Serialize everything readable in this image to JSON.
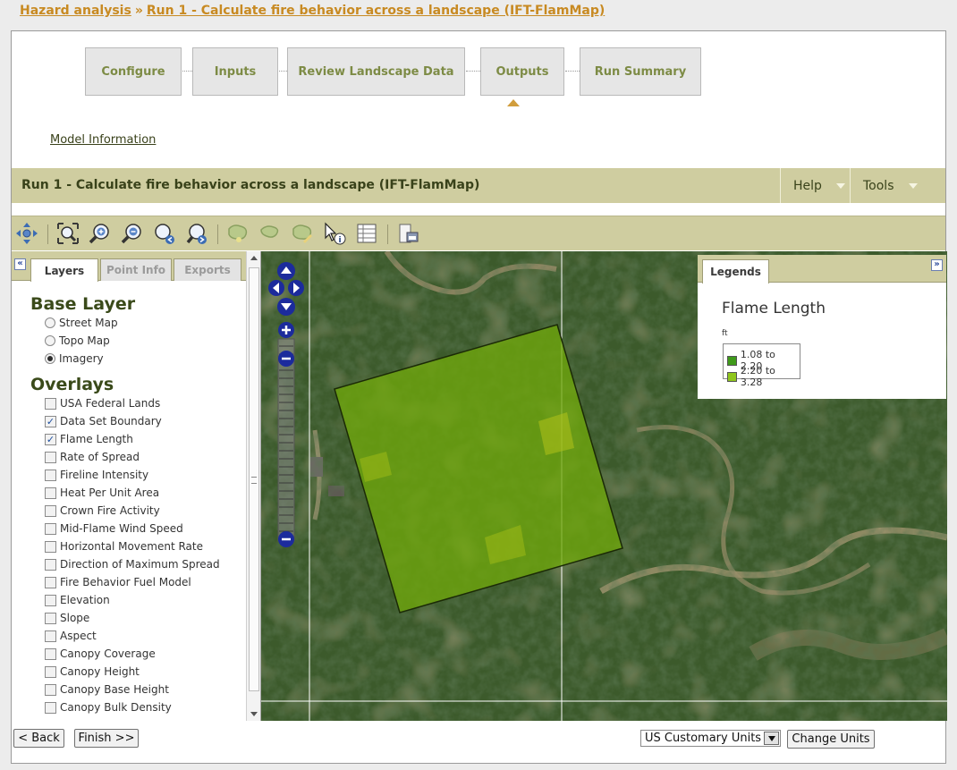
{
  "breadcrumb": {
    "root": "Hazard analysis",
    "separator": "»",
    "current": "Run 1 - Calculate fire behavior across a landscape (IFT-FlamMap)"
  },
  "steps": [
    {
      "label": "Configure"
    },
    {
      "label": "Inputs"
    },
    {
      "label": "Review Landscape Data"
    },
    {
      "label": "Outputs",
      "active": true
    },
    {
      "label": "Run Summary"
    }
  ],
  "model_info_link": "Model Information",
  "run": {
    "title": "Run 1 - Calculate fire behavior across a landscape (IFT-FlamMap)",
    "help_menu": "Help",
    "tools_menu": "Tools"
  },
  "toolbar": {
    "tools": [
      "pan-icon",
      "zoom-extent-icon",
      "zoom-in-icon",
      "zoom-out-icon",
      "zoom-previous-icon",
      "zoom-next-icon",
      "select-polygon-icon",
      "select-freehand-icon",
      "edit-polygon-icon",
      "identify-icon",
      "attribute-table-icon",
      "print-map-icon"
    ]
  },
  "left_panel": {
    "collapse_glyph": "«",
    "tabs": [
      {
        "label": "Layers",
        "active": true
      },
      {
        "label": "Point Info",
        "active": false
      },
      {
        "label": "Exports",
        "active": false
      }
    ],
    "base_layer_heading": "Base Layer",
    "base_layers": [
      {
        "label": "Street Map",
        "selected": false
      },
      {
        "label": "Topo Map",
        "selected": false
      },
      {
        "label": "Imagery",
        "selected": true
      }
    ],
    "overlays_heading": "Overlays",
    "overlays": [
      {
        "label": "USA Federal Lands",
        "checked": false
      },
      {
        "label": "Data Set Boundary",
        "checked": true
      },
      {
        "label": "Flame Length",
        "checked": true
      },
      {
        "label": "Rate of Spread",
        "checked": false
      },
      {
        "label": "Fireline Intensity",
        "checked": false
      },
      {
        "label": "Heat Per Unit Area",
        "checked": false
      },
      {
        "label": "Crown Fire Activity",
        "checked": false
      },
      {
        "label": "Mid-Flame Wind Speed",
        "checked": false
      },
      {
        "label": "Horizontal Movement Rate",
        "checked": false
      },
      {
        "label": "Direction of Maximum Spread",
        "checked": false
      },
      {
        "label": "Fire Behavior Fuel Model",
        "checked": false
      },
      {
        "label": "Elevation",
        "checked": false
      },
      {
        "label": "Slope",
        "checked": false
      },
      {
        "label": "Aspect",
        "checked": false
      },
      {
        "label": "Canopy Coverage",
        "checked": false
      },
      {
        "label": "Canopy Height",
        "checked": false
      },
      {
        "label": "Canopy Base Height",
        "checked": false
      },
      {
        "label": "Canopy Bulk Density",
        "checked": false
      }
    ]
  },
  "legend": {
    "tab_label": "Legends",
    "expand_glyph": "»",
    "title": "Flame Length",
    "unit": "ft",
    "items": [
      {
        "label": "1.08 to 2.20",
        "color": "#3f9a1a"
      },
      {
        "label": "2.20 to 3.28",
        "color": "#8fc61c"
      }
    ]
  },
  "map": {
    "zoom_level_fraction": 0.95,
    "overlay_color": "#6fa80c"
  },
  "footer": {
    "back_button": "< Back",
    "finish_button": "Finish >>",
    "units_selected": "US Customary Units",
    "change_units_button": "Change Units"
  }
}
